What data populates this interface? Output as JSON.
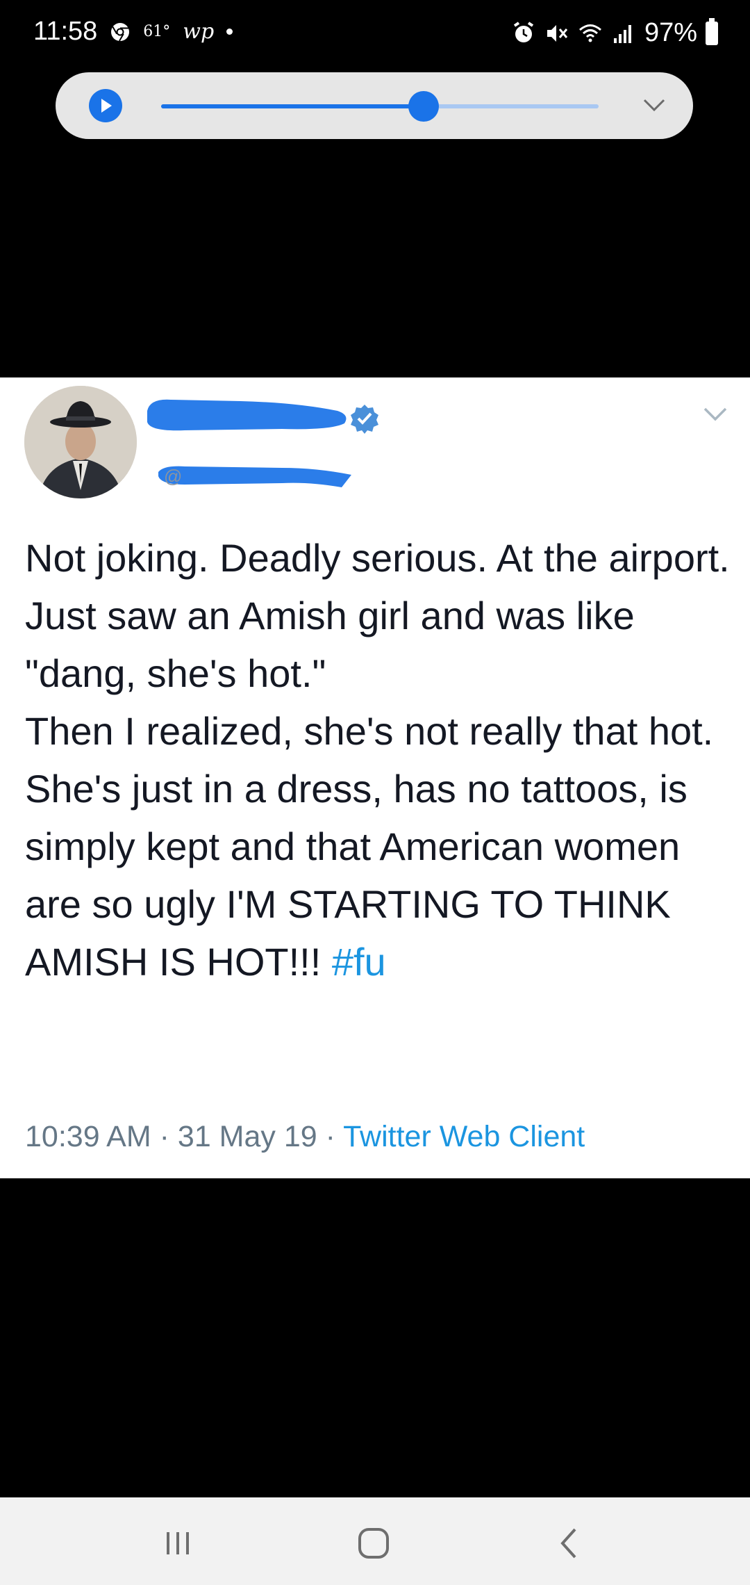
{
  "status_bar": {
    "time": "11:58",
    "temperature": "61°",
    "news_app": "wp",
    "battery_percent": "97%"
  },
  "media_control": {
    "progress": 0.6,
    "accent_color": "#1a73e8"
  },
  "tweet": {
    "display_name_redacted": true,
    "handle_redacted": true,
    "handle_prefix": "@",
    "verified": true,
    "text_lines": [
      "Not joking.  Deadly serious.  At the airport.",
      "Just saw an Amish girl and was like \"dang, she's hot.\"",
      "Then I realized, she's not really that hot.  She's just in a dress, has no tattoos, is simply kept and that American women are so ugly I'M STARTING TO THINK AMISH IS HOT!!! "
    ],
    "hashtag": "#fu",
    "time": "10:39 AM",
    "date": "31 May 19",
    "separator": " · ",
    "source": "Twitter Web Client",
    "link_color": "#1b95e0"
  },
  "icons": {
    "status_left": [
      "chrome-icon"
    ],
    "status_right": [
      "alarm-icon",
      "mute-icon",
      "wifi-icon",
      "signal-icon",
      "battery-icon"
    ],
    "nav": [
      "recents-icon",
      "home-icon",
      "back-icon"
    ]
  }
}
